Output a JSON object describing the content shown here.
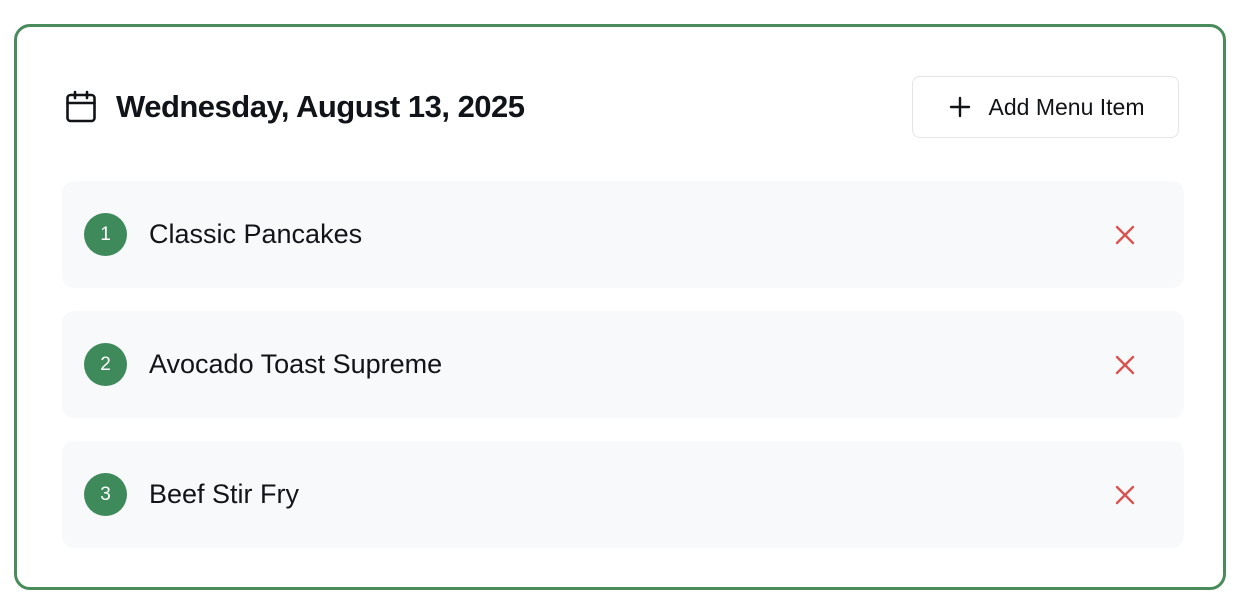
{
  "header": {
    "date_title": "Wednesday, August 13, 2025",
    "calendar_icon": "calendar-icon",
    "add_button_label": "Add Menu Item",
    "add_button_icon": "plus-icon"
  },
  "menu_items": [
    {
      "number": "1",
      "name": "Classic Pancakes"
    },
    {
      "number": "2",
      "name": "Avocado Toast Supreme"
    },
    {
      "number": "3",
      "name": "Beef Stir Fry"
    }
  ],
  "colors": {
    "accent_green": "#3f8a5b",
    "card_border": "#4a8b5c",
    "remove_red": "#d9534f",
    "item_bg": "#f8f9fb"
  }
}
